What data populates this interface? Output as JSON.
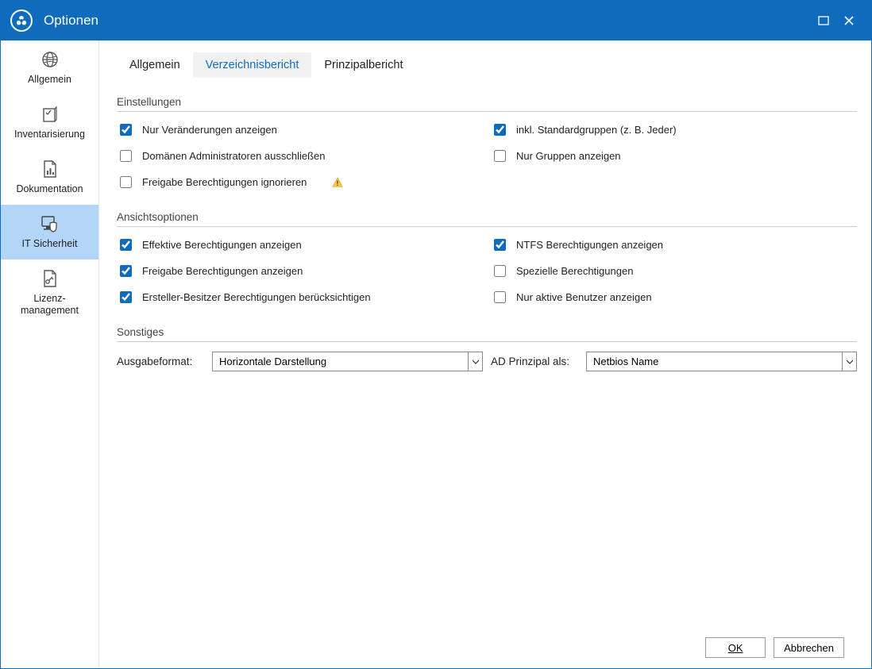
{
  "window": {
    "title": "Optionen"
  },
  "sidebar": {
    "items": [
      {
        "label": "Allgemein"
      },
      {
        "label": "Inventarisierung"
      },
      {
        "label": "Dokumentation"
      },
      {
        "label": "IT Sicherheit"
      },
      {
        "label": "Lizenz-\nmanagement"
      }
    ]
  },
  "tabs": [
    {
      "label": "Allgemein"
    },
    {
      "label": "Verzeichnisbericht"
    },
    {
      "label": "Prinzipalbericht"
    }
  ],
  "sections": {
    "settings_title": "Einstellungen",
    "view_title": "Ansichtsoptionen",
    "misc_title": "Sonstiges"
  },
  "settings": {
    "left": [
      {
        "label": "Nur Veränderungen anzeigen",
        "checked": true
      },
      {
        "label": "Domänen Administratoren ausschließen",
        "checked": false
      },
      {
        "label": "Freigabe Berechtigungen ignorieren",
        "checked": false,
        "warning": true
      }
    ],
    "right": [
      {
        "label": "inkl. Standardgruppen (z. B. Jeder)",
        "checked": true
      },
      {
        "label": "Nur Gruppen anzeigen",
        "checked": false
      }
    ]
  },
  "view": {
    "left": [
      {
        "label": "Effektive Berechtigungen anzeigen",
        "checked": true
      },
      {
        "label": "Freigabe Berechtigungen anzeigen",
        "checked": true
      },
      {
        "label": "Ersteller-Besitzer Berechtigungen berücksichtigen",
        "checked": true
      }
    ],
    "right": [
      {
        "label": "NTFS Berechtigungen anzeigen",
        "checked": true
      },
      {
        "label": "Spezielle Berechtigungen",
        "checked": false
      },
      {
        "label": "Nur aktive Benutzer anzeigen",
        "checked": false
      }
    ]
  },
  "misc": {
    "output_label": "Ausgabeformat:",
    "output_value": "Horizontale Darstellung",
    "principal_label": "AD Prinzipal als:",
    "principal_value": "Netbios Name"
  },
  "footer": {
    "ok": "OK",
    "cancel": "Abbrechen"
  }
}
